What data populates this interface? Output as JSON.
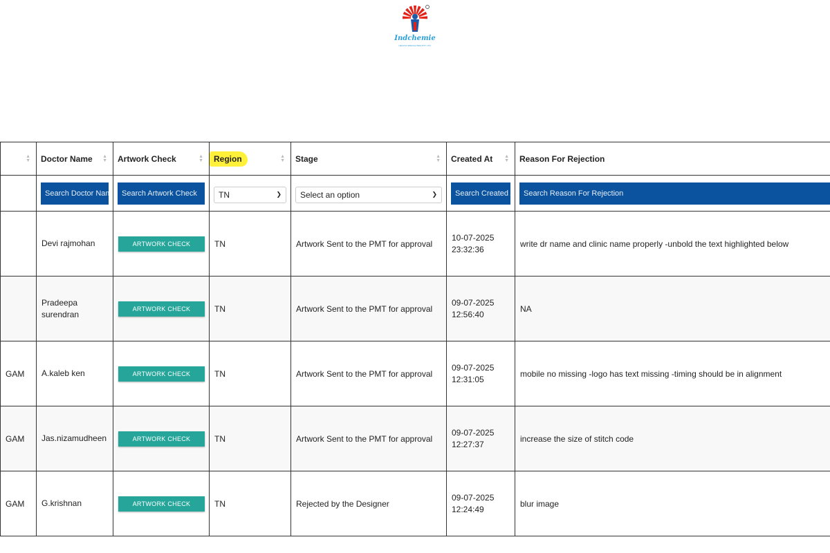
{
  "brand": {
    "logo_text": "Indchemie",
    "logo_subtext": "HEALTH SPECIALITIES PVT. LTD."
  },
  "table": {
    "columns": [
      "",
      "Doctor Name",
      "Artwork Check",
      "Region",
      "Stage",
      "Created At",
      "Reason For Rejection"
    ],
    "filters": {
      "doctor_placeholder": "Search Doctor Name",
      "artwork_placeholder": "Search Artwork Check",
      "region_selected": "TN",
      "stage_selected": "Select an option",
      "created_placeholder": "Search Created At",
      "reason_placeholder": "Search Reason For Rejection"
    },
    "rows": [
      {
        "first": "",
        "doctor": "Devi rajmohan",
        "artwork": "ARTWORK CHECK",
        "region": "TN",
        "stage": "Artwork Sent to the PMT for approval",
        "created_date": "10-07-2025",
        "created_time": "23:32:36",
        "reason": "write dr name and clinic name properly -unbold the text highlighted below"
      },
      {
        "first": "",
        "doctor": "Pradeepa surendran",
        "artwork": "ARTWORK CHECK",
        "region": "TN",
        "stage": "Artwork Sent to the PMT for approval",
        "created_date": "09-07-2025",
        "created_time": "12:56:40",
        "reason": "NA"
      },
      {
        "first": "GAM",
        "doctor": "A.kaleb ken",
        "artwork": "ARTWORK CHECK",
        "region": "TN",
        "stage": "Artwork Sent to the PMT for approval",
        "created_date": "09-07-2025",
        "created_time": "12:31:05",
        "reason": "mobile no missing -logo has text missing -timing should be in alignment"
      },
      {
        "first": "GAM",
        "doctor": "Jas.nizamudheen",
        "artwork": "ARTWORK CHECK",
        "region": "TN",
        "stage": "Artwork Sent to the PMT for approval",
        "created_date": "09-07-2025",
        "created_time": "12:27:37",
        "reason": "increase the size of stitch code"
      },
      {
        "first": "GAM",
        "doctor": "G.krishnan",
        "artwork": "ARTWORK CHECK",
        "region": "TN",
        "stage": "Rejected by the Designer",
        "created_date": "09-07-2025",
        "created_time": "12:24:49",
        "reason": "blur image"
      }
    ]
  },
  "colors": {
    "filter_bg": "#0b539f",
    "button_bg": "#26a69a",
    "highlight": "#fff13a",
    "logo": "#2a9fd6",
    "logo_red": "#e2231a"
  }
}
